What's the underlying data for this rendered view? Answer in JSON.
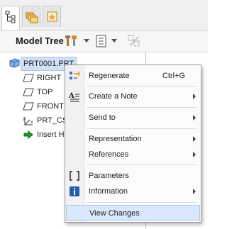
{
  "panel": {
    "title": "Model Tree",
    "tabs": [
      "model-tree-tab",
      "folder-browser-tab",
      "favorites-tab"
    ]
  },
  "tree": {
    "root": "PRT0001.PRT",
    "items": [
      {
        "label": "RIGHT",
        "icon": "datum-plane-icon"
      },
      {
        "label": "TOP",
        "icon": "datum-plane-icon"
      },
      {
        "label": "FRONT",
        "icon": "datum-plane-icon"
      },
      {
        "label": "PRT_CS",
        "icon": "coordinate-system-icon"
      },
      {
        "label": "Insert H",
        "icon": "insert-here-arrow-icon"
      }
    ]
  },
  "context_menu": {
    "items": [
      {
        "label": "Regenerate",
        "shortcut": "Ctrl+G",
        "submenu": false
      },
      {
        "label": "Create a Note",
        "shortcut": "",
        "submenu": true
      },
      {
        "label": "Send to",
        "shortcut": "",
        "submenu": true
      },
      {
        "label": "Representation",
        "shortcut": "",
        "submenu": true
      },
      {
        "label": "References",
        "shortcut": "",
        "submenu": true
      },
      {
        "label": "Parameters",
        "shortcut": "",
        "submenu": false
      },
      {
        "label": "Information",
        "shortcut": "",
        "submenu": true
      },
      {
        "label": "View Changes",
        "shortcut": "",
        "submenu": false,
        "highlighted": true
      }
    ]
  },
  "colors": {
    "selection": "#cfe0f7",
    "menu_highlight": "#d9e8fb",
    "accent_orange": "#e8a33a",
    "info_blue": "#1f5fa8"
  }
}
